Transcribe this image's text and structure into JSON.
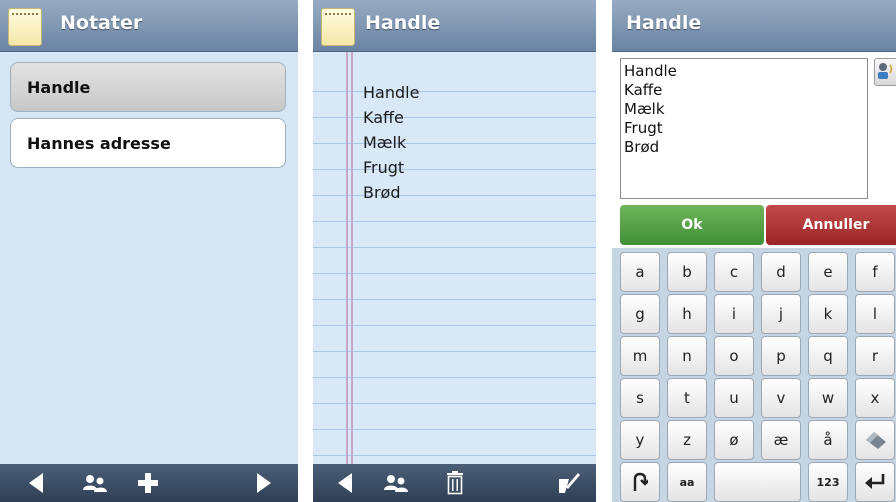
{
  "screen1": {
    "title": "Notater",
    "items": [
      {
        "label": "Handle"
      },
      {
        "label": "Hannes adresse"
      }
    ]
  },
  "screen2": {
    "title": "Handle",
    "lines": [
      "Handle",
      "Kaffe",
      "Mælk",
      "Frugt",
      "Brød"
    ]
  },
  "screen3": {
    "title": "Handle",
    "text_lines": [
      "Handle",
      "Kaffe",
      "Mælk",
      "Frugt",
      "Brød"
    ],
    "ok_label": "Ok",
    "cancel_label": "Annuller",
    "keys": {
      "row1": [
        "a",
        "b",
        "c",
        "d",
        "e",
        "f"
      ],
      "row2": [
        "g",
        "h",
        "i",
        "j",
        "k",
        "l"
      ],
      "row3": [
        "m",
        "n",
        "o",
        "p",
        "q",
        "r"
      ],
      "row4": [
        "s",
        "t",
        "u",
        "v",
        "w",
        "x"
      ],
      "row5": [
        "y",
        "z",
        "ø",
        "æ",
        "å"
      ],
      "row6_case": "aa",
      "row6_numbers": "123"
    }
  },
  "colors": {
    "titlebar": "#7f95b0",
    "list_bg": "#d7e6f4",
    "bottombar": "#3a4b62",
    "ok_green": "#4fa043",
    "cancel_red": "#b03333"
  }
}
